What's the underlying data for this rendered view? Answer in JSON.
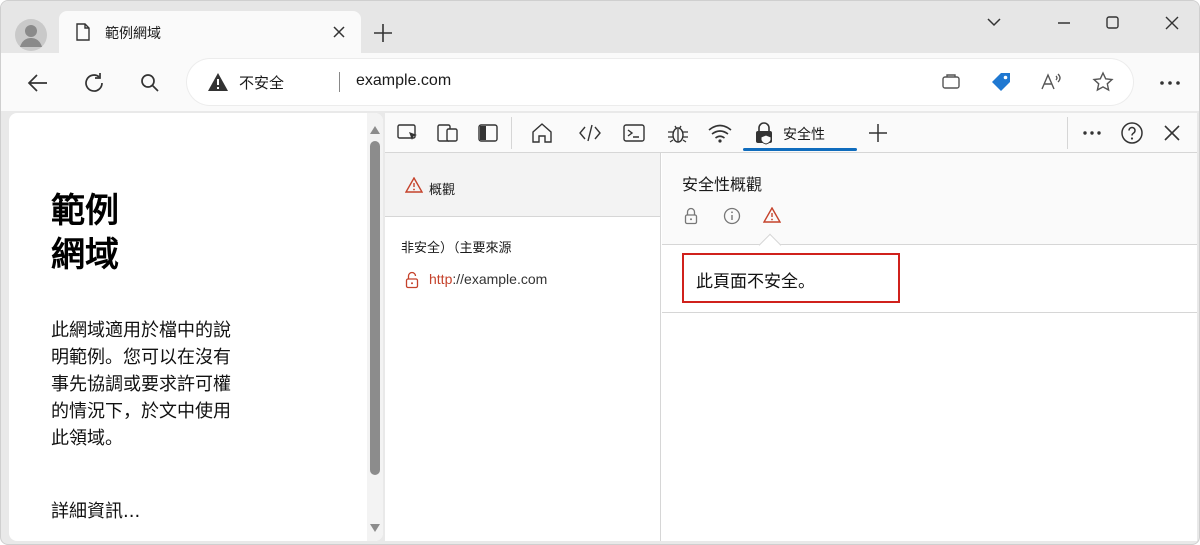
{
  "tab": {
    "title": "範例網域"
  },
  "address": {
    "security_label": "不安全",
    "url": "example.com"
  },
  "page": {
    "heading": "範例網域",
    "paragraph": "此網域適用於檔中的說明範例。您可以在沒有事先協調或要求許可權的情況下，於文中使用此領域。",
    "more_link": "詳細資訊..."
  },
  "devtools": {
    "active_tab": "安全性",
    "sidebar": {
      "overview": "概觀",
      "origin_heading": "非安全）（主要來源",
      "origin_scheme": "http",
      "origin_rest": "://example.com"
    },
    "panel": {
      "title": "安全性概觀",
      "message": "此頁面不安全。"
    }
  },
  "colors": {
    "accent": "#0f6cbd",
    "warning": "#c5422b",
    "highlight_border": "#d0211c",
    "collections_icon": "#1f78d1"
  },
  "icons": {
    "titlebar": [
      "profile-icon",
      "page-icon",
      "close-icon",
      "plus-icon",
      "minimize-icon",
      "maximize-icon",
      "close-window-icon"
    ],
    "toolbar": [
      "back-arrow-icon",
      "refresh-icon",
      "search-icon",
      "warning-icon",
      "tab-actions-icon",
      "collections-icon",
      "read-aloud-icon",
      "favorite-star-icon",
      "more-icon"
    ],
    "devtools": [
      "inspect-icon",
      "device-emulation-icon",
      "dock-icon",
      "welcome-home-icon",
      "elements-icon",
      "console-icon",
      "sources-bug-icon",
      "network-wifi-icon",
      "security-lock-icon",
      "add-tool-icon",
      "more-tools-icon",
      "help-icon",
      "close-devtools-icon"
    ]
  }
}
